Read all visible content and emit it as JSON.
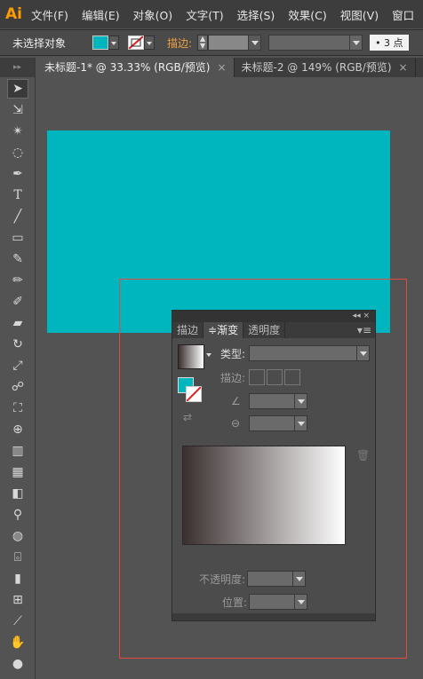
{
  "app": {
    "logo": "Ai"
  },
  "menu": [
    "文件(F)",
    "编辑(E)",
    "对象(O)",
    "文字(T)",
    "选择(S)",
    "效果(C)",
    "视图(V)",
    "窗口"
  ],
  "control": {
    "no_selection": "未选择对象",
    "stroke_label": "描边:",
    "stroke_weight": "• 3 点"
  },
  "tabs": [
    {
      "label": "未标题-1* @ 33.33% (RGB/预览)",
      "close": "×"
    },
    {
      "label": "未标题-2 @ 149% (RGB/预览)",
      "close": "×"
    }
  ],
  "colors": {
    "fill": "#00b6be",
    "artboard_border": "#e04a3f",
    "accent_orange": "#ff9a00"
  },
  "panel": {
    "collapse": "◂◂ ×",
    "tabs": [
      "描边",
      "≑渐变",
      "透明度"
    ],
    "menu_icon": "▾≡",
    "type_label": "类型:",
    "stroke_label": "描边:",
    "opacity_label": "不透明度:",
    "position_label": "位置:",
    "grad_start": "#3a2f2f",
    "grad_end": "#ffffff"
  },
  "tools": [
    "selection-arrow",
    "direct-select",
    "magic-wand",
    "lasso",
    "pen",
    "type",
    "line",
    "rectangle",
    "paintbrush",
    "pencil",
    "blob-brush",
    "eraser",
    "rotate",
    "scale",
    "warp",
    "free-transform",
    "shape-builder",
    "perspective",
    "mesh",
    "gradient",
    "eyedropper",
    "blend",
    "symbol",
    "graph",
    "artboard",
    "slice",
    "hand",
    "zoom"
  ]
}
